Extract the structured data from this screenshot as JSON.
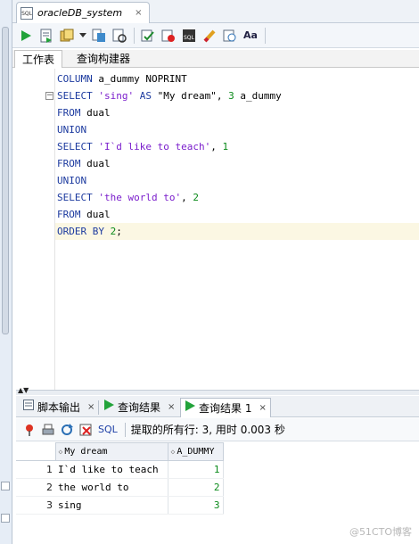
{
  "editor_tab": {
    "title": "oracleDB_system",
    "icon": "sql-file-icon",
    "close": "×"
  },
  "toolbar": {
    "icons": [
      "run-statement-icon",
      "run-script-icon",
      "commit-icon",
      "dropdown-icon",
      "explain-plan-icon",
      "autotrace-icon",
      "rollback-icon",
      "sql-tuning-icon",
      "sql-file-icon",
      "clear-icon",
      "history-icon",
      "format-icon"
    ]
  },
  "worksheet_tabs": [
    "工作表",
    "查询构建器"
  ],
  "code_lines": [
    [
      {
        "t": "COLUMN",
        "c": "kw"
      },
      {
        "t": " a_dummy NOPRINT",
        "c": "txt"
      }
    ],
    [
      {
        "t": "SELECT",
        "c": "kw"
      },
      {
        "t": " ",
        "c": "txt"
      },
      {
        "t": "'sing'",
        "c": "str"
      },
      {
        "t": " ",
        "c": "txt"
      },
      {
        "t": "AS",
        "c": "kw"
      },
      {
        "t": " \"My dream\", ",
        "c": "txt"
      },
      {
        "t": "3",
        "c": "num"
      },
      {
        "t": " a_dummy",
        "c": "txt"
      }
    ],
    [
      {
        "t": "FROM",
        "c": "kw"
      },
      {
        "t": " dual",
        "c": "txt"
      }
    ],
    [
      {
        "t": "UNION",
        "c": "kw"
      }
    ],
    [
      {
        "t": "SELECT",
        "c": "kw"
      },
      {
        "t": " ",
        "c": "txt"
      },
      {
        "t": "'I`d like to teach'",
        "c": "str"
      },
      {
        "t": ", ",
        "c": "txt"
      },
      {
        "t": "1",
        "c": "num"
      }
    ],
    [
      {
        "t": "FROM",
        "c": "kw"
      },
      {
        "t": " dual",
        "c": "txt"
      }
    ],
    [
      {
        "t": "UNION",
        "c": "kw"
      }
    ],
    [
      {
        "t": "SELECT",
        "c": "kw"
      },
      {
        "t": " ",
        "c": "txt"
      },
      {
        "t": "'the world to'",
        "c": "str"
      },
      {
        "t": ", ",
        "c": "txt"
      },
      {
        "t": "2",
        "c": "num"
      }
    ],
    [
      {
        "t": "FROM",
        "c": "kw"
      },
      {
        "t": " dual",
        "c": "txt"
      }
    ],
    [
      {
        "t": "ORDER BY",
        "c": "kw"
      },
      {
        "t": " ",
        "c": "txt"
      },
      {
        "t": "2",
        "c": "num"
      },
      {
        "t": ";",
        "c": "txt"
      }
    ]
  ],
  "result_tabs": [
    {
      "label": "脚本输出",
      "icon": "script-output-icon",
      "close": "×",
      "active": false
    },
    {
      "label": "查询结果",
      "icon": "run-result-icon",
      "close": "×",
      "active": false
    },
    {
      "label": "查询结果 1",
      "icon": "run-result-icon",
      "close": "×",
      "active": true
    }
  ],
  "result_toolbar": {
    "sql_label": "SQL",
    "status": "提取的所有行: 3, 用时 0.003 秒"
  },
  "grid": {
    "columns": [
      "My dream",
      "A_DUMMY"
    ],
    "rows": [
      {
        "n": "1",
        "dream": "I`d like to teach",
        "dummy": "1"
      },
      {
        "n": "2",
        "dream": "the world to",
        "dummy": "2"
      },
      {
        "n": "3",
        "dream": "sing",
        "dummy": "3"
      }
    ]
  },
  "watermark": "@51CTO博客"
}
